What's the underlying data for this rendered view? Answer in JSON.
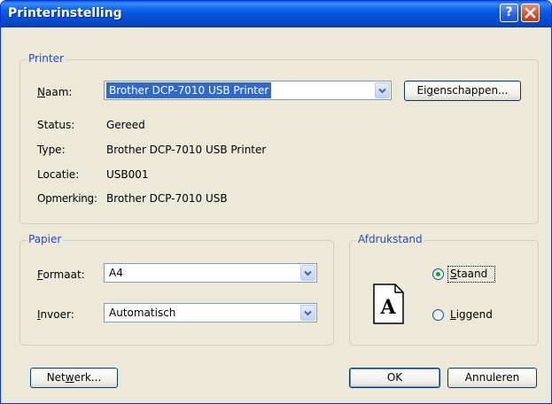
{
  "window": {
    "title": "Printerinstelling"
  },
  "icons": {
    "help": "help-question-icon",
    "close": "close-x-icon",
    "dropdown": "chevron-down-icon",
    "orientation": "portrait-page-A-icon"
  },
  "colors": {
    "titlebar": "#0a5fe6",
    "legend": "#1f49d6",
    "selection": "#316ac5",
    "radio_dot": "#21a121",
    "close": "#d5552f"
  },
  "printer_group": {
    "legend": "Printer",
    "name_label": "Naam:",
    "name_value": "Brother DCP-7010 USB Printer",
    "properties_button": "Eigenschappen...",
    "status_label": "Status:",
    "status_value": "Gereed",
    "type_label": "Type:",
    "type_value": "Brother DCP-7010 USB Printer",
    "location_label": "Locatie:",
    "location_value": "USB001",
    "comment_label": "Opmerking:",
    "comment_value": "Brother DCP-7010 USB"
  },
  "paper_group": {
    "legend": "Papier",
    "format_label": "Formaat:",
    "format_value": "A4",
    "source_label": "Invoer:",
    "source_value": "Automatisch"
  },
  "orientation_group": {
    "legend": "Afdrukstand",
    "preview_letter": "A",
    "portrait_label": "Staand",
    "landscape_label": "Liggend",
    "selected": "Staand"
  },
  "buttons": {
    "network": "Netwerk...",
    "ok": "OK",
    "cancel": "Annuleren"
  }
}
